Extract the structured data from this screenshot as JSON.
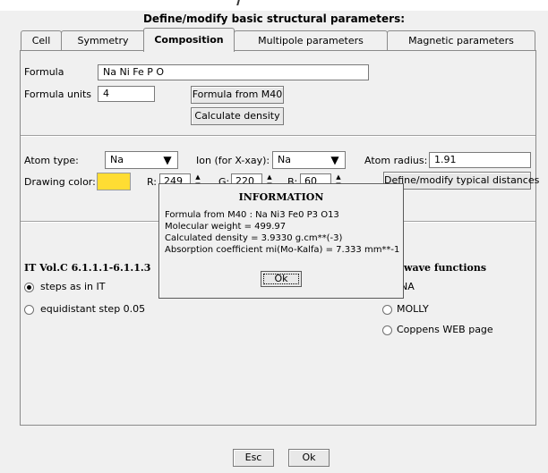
{
  "title": "Define/modify basic structural parameters:",
  "tabs": [
    {
      "label": "Cell"
    },
    {
      "label": "Symmetry"
    },
    {
      "label": "Composition"
    },
    {
      "label": "Multipole parameters"
    },
    {
      "label": "Magnetic parameters"
    }
  ],
  "composition": {
    "formula_label": "Formula",
    "formula_value": "Na Ni Fe P O",
    "formula_units_label": "Formula units",
    "formula_units_value": "4",
    "formula_from_m40_button": "Formula from M40",
    "calculate_density_button": "Calculate density"
  },
  "atom": {
    "atom_type_label": "Atom type:",
    "atom_type_value": "Na",
    "ion_label": "Ion (for X-xay):",
    "ion_value": "Na",
    "atom_radius_label": "Atom radius:",
    "atom_radius_value": "1.91",
    "drawing_color_label": "Drawing color:",
    "drawing_color": "#ffdd33",
    "r_label": "R:",
    "r_value": "249",
    "g_label": "G:",
    "g_value": "220",
    "b_label": "B:",
    "b_value": "60",
    "define_distances_button": "Define/modify typical distances"
  },
  "itvol": {
    "label": "IT Vol.C 6.1.1.1-6.1.1.3",
    "options": [
      {
        "label": "steps as in IT",
        "selected": true
      },
      {
        "label": "equidistant step 0.05",
        "selected": false
      }
    ]
  },
  "wave": {
    "label": "wave functions",
    "options": [
      {
        "label": "NA",
        "selected": false
      },
      {
        "label": "MOLLY",
        "selected": false
      },
      {
        "label": "Coppens WEB page",
        "selected": false
      }
    ]
  },
  "info": {
    "title": "INFORMATION",
    "lines": [
      "Formula from M40 : Na Ni3 Fe0 P3 O13",
      "Molecular weight =  499.97",
      "Calculated density = 3.9330 g.cm**(-3)",
      "Absorption coefficient mi(Mo-Kalfa) =   7.333 mm**-1"
    ],
    "ok_button": "Ok"
  },
  "footer": {
    "esc_button": "Esc",
    "ok_button": "Ok"
  }
}
